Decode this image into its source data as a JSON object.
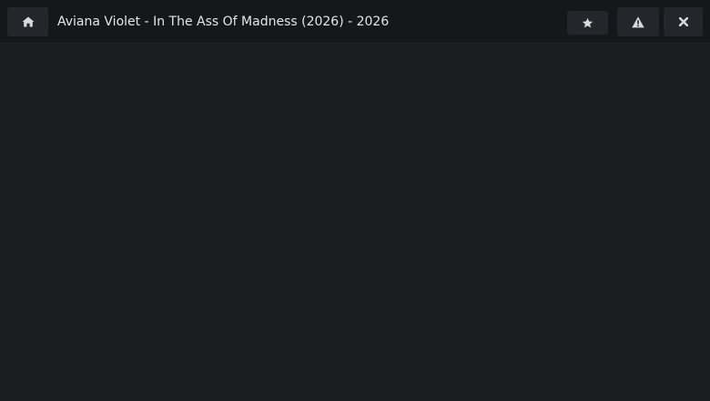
{
  "header": {
    "title": "Aviana Violet - In The Ass Of Madness (2026) - 2026",
    "buttons": {
      "home": {
        "icon": "home-icon"
      },
      "favorite": {
        "icon": "star-icon"
      },
      "report": {
        "icon": "warning-icon"
      },
      "close": {
        "icon": "close-icon"
      }
    }
  },
  "colors": {
    "background": "#1b1d21",
    "topbar": "#15171a",
    "button": "#24262b",
    "text": "#e4e5e8",
    "icon": "#d9dade"
  }
}
